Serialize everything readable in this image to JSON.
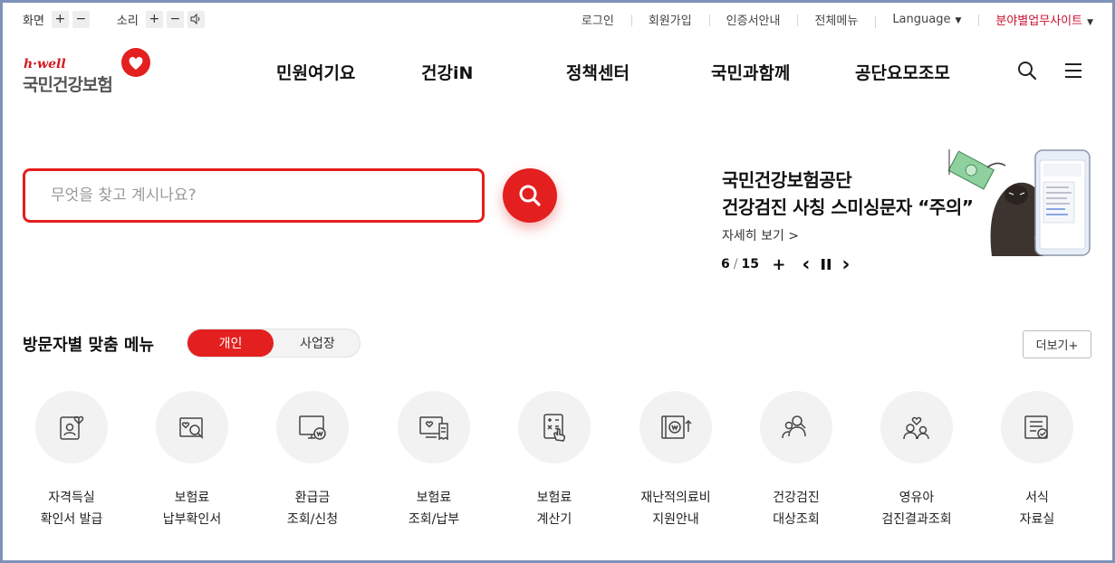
{
  "utility": {
    "screen_label": "화면",
    "sound_label": "소리",
    "plus": "+",
    "minus": "−"
  },
  "topnav": {
    "login": "로그인",
    "join": "회원가입",
    "cert": "인증서안내",
    "allmenu": "전체메뉴",
    "language": "Language",
    "sites": "분야별업무사이트"
  },
  "logo": {
    "brand_en": "h·well",
    "brand_kr": "국민건강보험"
  },
  "gnb": [
    "민원여기요",
    "건강iN",
    "정책센터",
    "국민과함께",
    "공단요모조모"
  ],
  "search": {
    "placeholder": "무엇을 찾고 계시나요?"
  },
  "banner": {
    "title_line1": "국민건강보험공단",
    "title_line2": "건강검진 사칭 스미싱문자 “주의”",
    "more": "자세히 보기 >",
    "current": "6",
    "total": "15",
    "separator": "/",
    "add": "+",
    "prev": "‹",
    "next": "›"
  },
  "custom_menu": {
    "title": "방문자별 맞춤 메뉴",
    "tab_personal": "개인",
    "tab_business": "사업장",
    "more": "더보기+",
    "items": [
      {
        "line1": "자격득실",
        "line2": "확인서 발급",
        "icon": "id-card-heart-icon"
      },
      {
        "line1": "보험료",
        "line2": "납부확인서",
        "icon": "search-document-icon"
      },
      {
        "line1": "환급금",
        "line2": "조회/신청",
        "icon": "refund-monitor-icon"
      },
      {
        "line1": "보험료",
        "line2": "조회/납부",
        "icon": "monitor-receipt-icon"
      },
      {
        "line1": "보험료",
        "line2": "계산기",
        "icon": "calculator-icon"
      },
      {
        "line1": "재난적의료비",
        "line2": "지원안내",
        "icon": "medical-cost-icon"
      },
      {
        "line1": "건강검진",
        "line2": "대상조회",
        "icon": "people-icon"
      },
      {
        "line1": "영유아",
        "line2": "검진결과조회",
        "icon": "parent-child-icon"
      },
      {
        "line1": "서식",
        "line2": "자료실",
        "icon": "form-document-icon"
      }
    ]
  },
  "colors": {
    "brand_red": "#e31f1f",
    "frame": "#7d93b9"
  }
}
